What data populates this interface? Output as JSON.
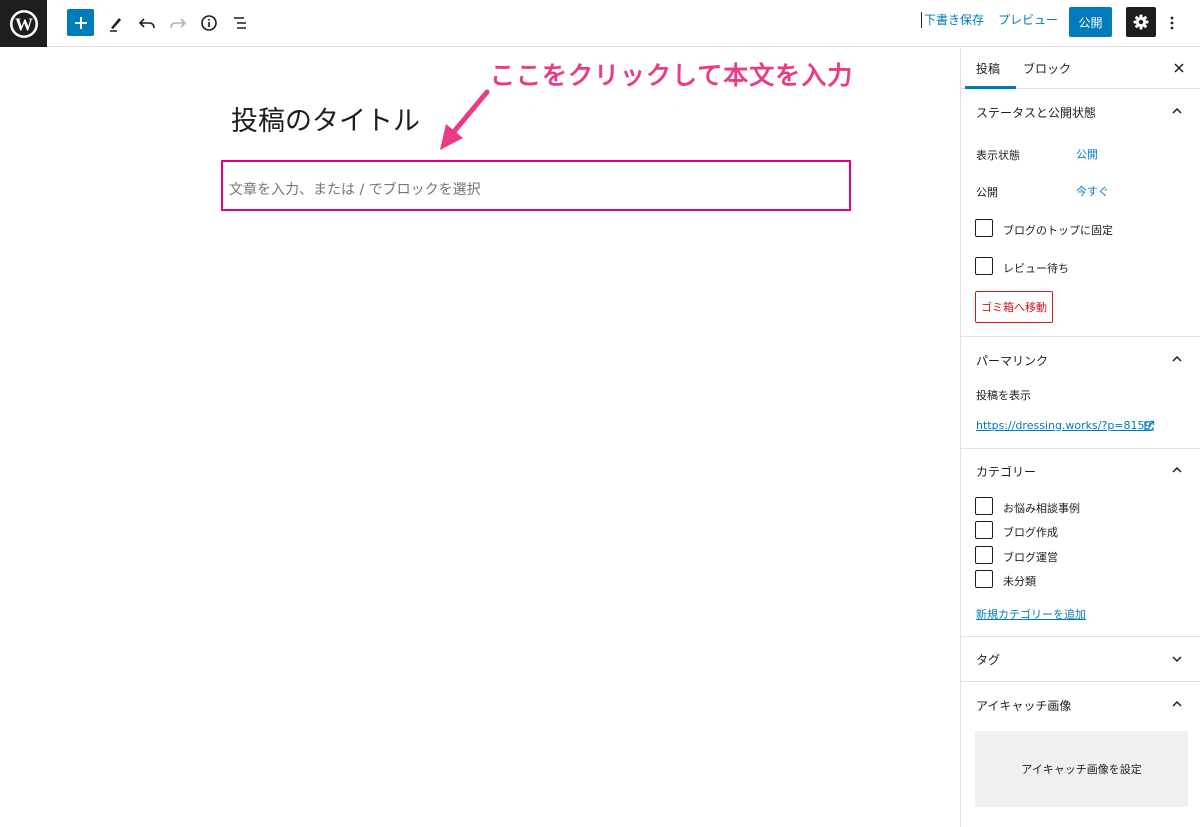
{
  "toolbar": {
    "save_draft": "下書き保存",
    "preview": "プレビュー",
    "publish": "公開"
  },
  "editor": {
    "annotation": "ここをクリックして本文を入力",
    "post_title": "投稿のタイトル",
    "body_placeholder": "文章を入力、または / でブロックを選択"
  },
  "sidebar": {
    "tabs": {
      "post": "投稿",
      "block": "ブロック"
    },
    "status": {
      "title": "ステータスと公開状態",
      "visibility_label": "表示状態",
      "visibility_value": "公開",
      "publish_label": "公開",
      "publish_value": "今すぐ",
      "sticky_label": "ブログのトップに固定",
      "pending_label": "レビュー待ち",
      "trash_button": "ゴミ箱へ移動"
    },
    "permalink": {
      "title": "パーマリンク",
      "view_label": "投稿を表示",
      "url": "https://dressing.works/?p=8159"
    },
    "categories": {
      "title": "カテゴリー",
      "items": [
        "お悩み相談事例",
        "ブログ作成",
        "ブログ運営",
        "未分類"
      ],
      "add_new": "新規カテゴリーを追加"
    },
    "tags": {
      "title": "タグ"
    },
    "featured_image": {
      "title": "アイキャッチ画像",
      "set_button": "アイキャッチ画像を設定"
    }
  },
  "colors": {
    "accent": "#007cba",
    "highlight_border": "#e6007e",
    "annotation": "#ec3a86",
    "danger": "#cc1818"
  }
}
